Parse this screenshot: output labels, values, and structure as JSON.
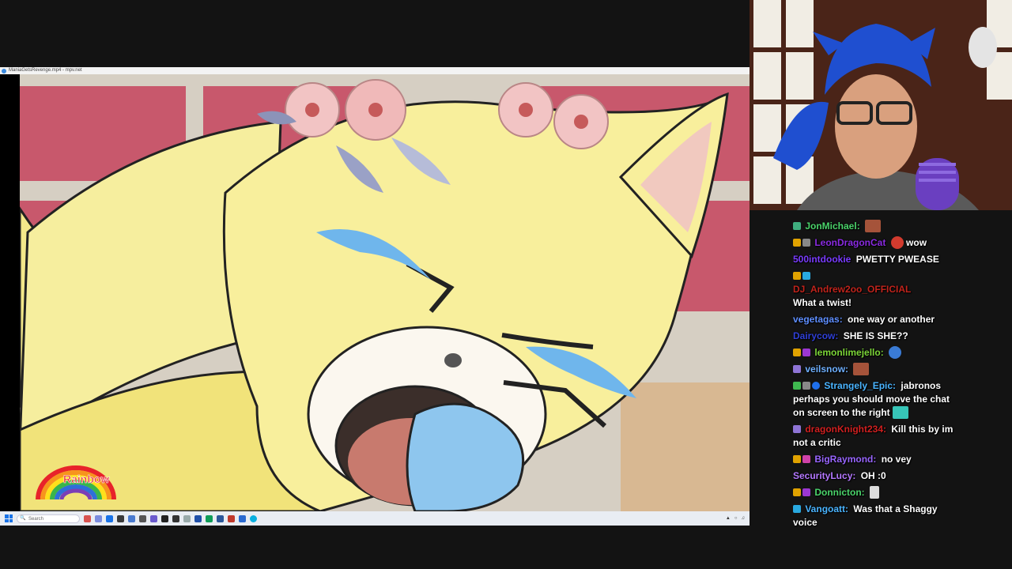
{
  "player": {
    "title": "ManiaGetsRevenge.mp4 - mpv.net"
  },
  "video": {
    "logo_text": "Rainbow"
  },
  "taskbar": {
    "search_placeholder": "Search",
    "tray_icons": [
      "chevron-up-icon",
      "network-icon",
      "volume-icon",
      "clock"
    ]
  },
  "chat": {
    "messages": [
      {
        "user": "JonMichael:",
        "user_color": "#4bd46b",
        "text": "",
        "badges": [
          "#3fae7f"
        ],
        "emote": "face-emote"
      },
      {
        "user": "LeonDragonCat",
        "user_color": "#8a2be2",
        "text": "wow",
        "badges": [
          "#e0a200",
          "#888888"
        ],
        "emote": "mario-emote"
      },
      {
        "user": "500intdookie",
        "user_color": "#7a3cff",
        "text": "PWETTY PWEASE",
        "badges": [],
        "emote": ""
      },
      {
        "user": "DJ_Andrew2oo_OFFICIAL",
        "user_color": "#c0241c",
        "text": "What a twist!",
        "badges": [
          "#e0a200",
          "#29a9e0"
        ],
        "emote": ""
      },
      {
        "user": "vegetagas:",
        "user_color": "#5f8fff",
        "text": "one way or another",
        "badges": [],
        "emote": ""
      },
      {
        "user": "Dairycow:",
        "user_color": "#3040d8",
        "text": "SHE IS SHE??",
        "badges": [],
        "emote": ""
      },
      {
        "user": "lemonlimejello:",
        "user_color": "#7cd638",
        "text": "",
        "badges": [
          "#e0a200",
          "#9b37d1"
        ],
        "emote": "genie-emote"
      },
      {
        "user": "veilsnow:",
        "user_color": "#6fb0ff",
        "text": "",
        "badges": [
          "#8f75d6"
        ],
        "emote": "face-emote"
      },
      {
        "user": "Strangely_Epic:",
        "user_color": "#4ab4ff",
        "text": "jabronos perhaps you should move the chat on screen to the right",
        "badges": [
          "#3fb950",
          "#888888",
          "#1f6feb"
        ],
        "emote": "diamond-emote"
      },
      {
        "user": "dragonKnight234:",
        "user_color": "#d02020",
        "text": "Kill this by im not a critic",
        "badges": [
          "#8f75d6"
        ],
        "emote": ""
      },
      {
        "user": "BigRaymond:",
        "user_color": "#9966ff",
        "text": "no vey",
        "badges": [
          "#e0a200",
          "#d042a8"
        ],
        "emote": ""
      },
      {
        "user": "SecurityLucy:",
        "user_color": "#b478ff",
        "text": "OH :0",
        "badges": [],
        "emote": ""
      },
      {
        "user": "Donnicton:",
        "user_color": "#4bd46b",
        "text": "",
        "badges": [
          "#e0a200",
          "#9b37d1"
        ],
        "emote": "feather-emote"
      },
      {
        "user": "Vangoatt:",
        "user_color": "#4ab4ff",
        "text": "Was that a Shaggy voice",
        "badges": [
          "#29a9e0"
        ],
        "emote": ""
      }
    ]
  }
}
